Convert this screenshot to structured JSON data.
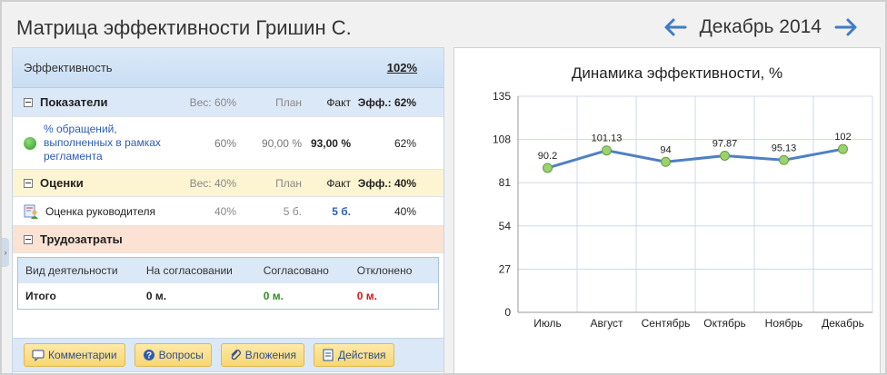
{
  "header": {
    "title": "Матрица эффективности Гришин С.",
    "period": "Декабрь 2014"
  },
  "efficiency": {
    "label": "Эффективность",
    "value": "102%"
  },
  "indicators": {
    "title": "Показатели",
    "weight": "Вес: 60%",
    "plan": "План",
    "fact": "Факт",
    "eff": "Эфф.: 62%",
    "items": [
      {
        "name": "% обращений, выполненных в рамках регламента",
        "weight": "60%",
        "plan": "90,00 %",
        "fact": "93,00 %",
        "eff": "62%"
      }
    ]
  },
  "ratings": {
    "title": "Оценки",
    "weight": "Вес: 40%",
    "plan": "План",
    "fact": "Факт",
    "eff": "Эфф.: 40%",
    "items": [
      {
        "name": "Оценка руководителя",
        "weight": "40%",
        "plan": "5 б.",
        "fact": "5 б.",
        "eff": "40%"
      }
    ]
  },
  "labor": {
    "title": "Трудозатраты",
    "headers": [
      "Вид деятельности",
      "На согласовании",
      "Согласовано",
      "Отклонено"
    ],
    "total": {
      "label": "Итого",
      "pending": "0 м.",
      "approved": "0 м.",
      "rejected": "0 м."
    }
  },
  "toolbar": {
    "comments": "Комментарии",
    "questions": "Вопросы",
    "attachments": "Вложения",
    "actions": "Действия"
  },
  "colors": {
    "line": "#4f7fc4",
    "point": "#9ad36a",
    "green": "#2f8f1e",
    "red": "#d21a1a"
  },
  "chart_data": {
    "type": "line",
    "title": "Динамика эффективности, %",
    "categories": [
      "Июль",
      "Август",
      "Сентябрь",
      "Октябрь",
      "Ноябрь",
      "Декабрь"
    ],
    "values": [
      90.2,
      101.13,
      94,
      97.87,
      95.13,
      102
    ],
    "data_labels": [
      "90.2",
      "101.13",
      "94",
      "97.87",
      "95.13",
      "102"
    ],
    "ylim": [
      0,
      135
    ],
    "yticks": [
      0,
      27,
      54,
      81,
      108,
      135
    ],
    "grid": true
  }
}
